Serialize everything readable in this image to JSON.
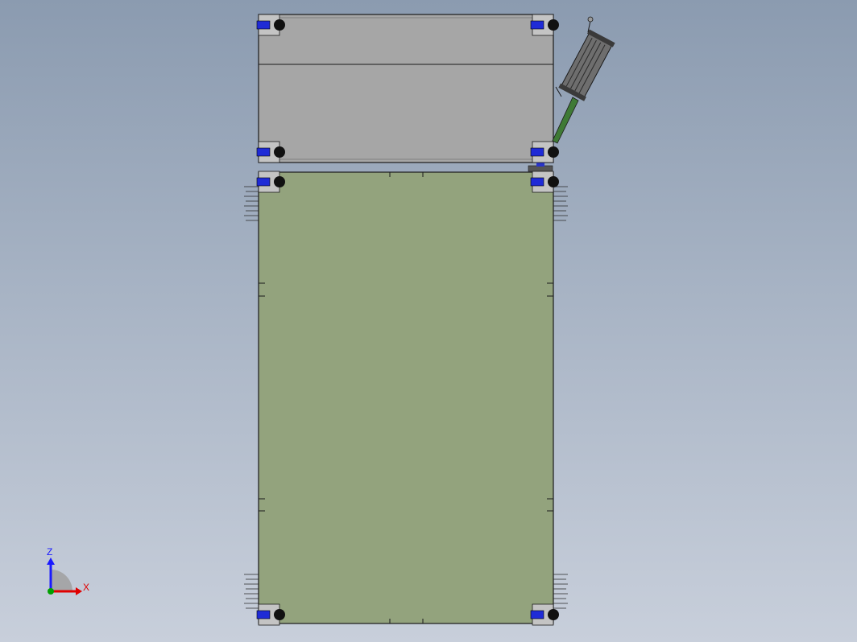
{
  "triad": {
    "z_label": "Z",
    "x_label": "X",
    "z_color": "#1a1aff",
    "x_color": "#e00000",
    "y_color": "#00a000"
  },
  "colors": {
    "background_top": "#8b9bb0",
    "background_bottom": "#c8cfdb",
    "upper_panel": "#a6a6a6",
    "lower_panel": "#93a37d",
    "caster_mount": "#1f2bd6",
    "actuator_rod": "#3f7a35",
    "outline": "#1a1a1a"
  },
  "icons": [
    "caster-wheel-icon",
    "linear-actuator-icon",
    "coordinate-triad-icon"
  ]
}
